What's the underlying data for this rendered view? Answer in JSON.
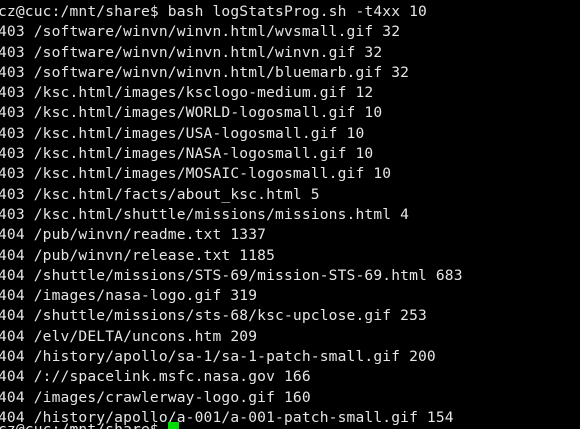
{
  "terminal": {
    "command_line": "cz@cuc:/mnt/share$ bash logStatsProg.sh -t4xx 10",
    "output_lines": [
      "403 /software/winvn/winvn.html/wvsmall.gif 32",
      "403 /software/winvn/winvn.html/winvn.gif 32",
      "403 /software/winvn/winvn.html/bluemarb.gif 32",
      "403 /ksc.html/images/ksclogo-medium.gif 12",
      "403 /ksc.html/images/WORLD-logosmall.gif 10",
      "403 /ksc.html/images/USA-logosmall.gif 10",
      "403 /ksc.html/images/NASA-logosmall.gif 10",
      "403 /ksc.html/images/MOSAIC-logosmall.gif 10",
      "403 /ksc.html/facts/about_ksc.html 5",
      "403 /ksc.html/shuttle/missions/missions.html 4",
      "404 /pub/winvn/readme.txt 1337",
      "404 /pub/winvn/release.txt 1185",
      "404 /shuttle/missions/STS-69/mission-STS-69.html 683",
      "404 /images/nasa-logo.gif 319",
      "404 /shuttle/missions/sts-68/ksc-upclose.gif 253",
      "404 /elv/DELTA/uncons.htm 209",
      "404 /history/apollo/sa-1/sa-1-patch-small.gif 200",
      "404 /://spacelink.msfc.nasa.gov 166",
      "404 /images/crawlerway-logo.gif 160",
      "404 /history/apollo/a-001/a-001-patch-small.gif 154"
    ],
    "final_prompt": "cz@cuc:/mnt/share$ ",
    "colors": {
      "background": "#000000",
      "text": "#e6e6e6",
      "cursor": "#00dd00"
    }
  }
}
